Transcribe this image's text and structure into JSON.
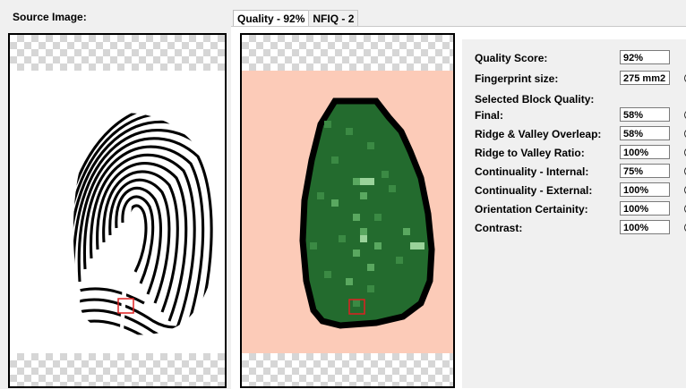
{
  "source": {
    "label": "Source Image:"
  },
  "tabs": [
    {
      "label": "Quality - 92%",
      "active": true
    },
    {
      "label": "NFIQ - 2",
      "active": false
    }
  ],
  "metrics": {
    "quality_score": {
      "label": "Quality Score:",
      "value": "92%"
    },
    "fingerprint_size": {
      "label": "Fingerprint size:",
      "value": "275 mm2"
    },
    "selected_block_label": "Selected Block Quality:",
    "items": [
      {
        "label": "Final:",
        "value": "58%",
        "selected": true
      },
      {
        "label": "Ridge & Valley Overleap:",
        "value": "58%",
        "selected": false
      },
      {
        "label": "Ridge to Valley Ratio:",
        "value": "100%",
        "selected": false
      },
      {
        "label": "Continuality - Internal:",
        "value": "75%",
        "selected": false
      },
      {
        "label": "Continuality - External:",
        "value": "100%",
        "selected": false
      },
      {
        "label": "Orientation Certainity:",
        "value": "100%",
        "selected": false
      },
      {
        "label": "Contrast:",
        "value": "100%",
        "selected": false
      }
    ]
  },
  "colors": {
    "quality_background": "#fccbb8",
    "quality_green": "#236b2e",
    "marker": "#e02020"
  }
}
